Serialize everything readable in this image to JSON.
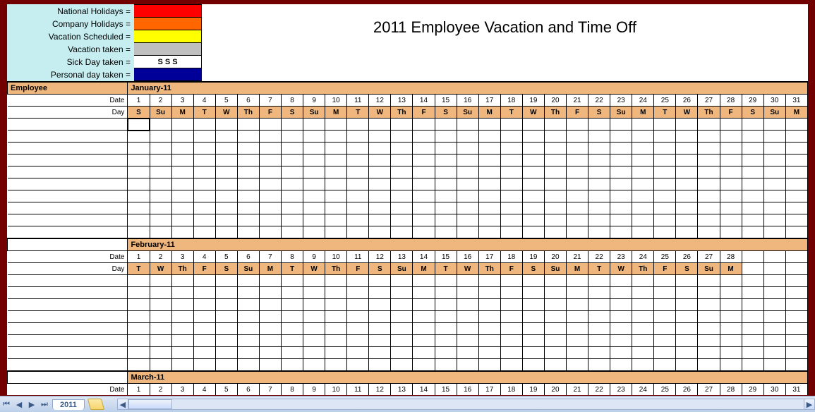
{
  "title": "2011 Employee Vacation and Time Off",
  "legend": [
    {
      "label": "National Holidays =",
      "color": "#ff0000",
      "text": ""
    },
    {
      "label": "Company Holidays =",
      "color": "#ff6600",
      "text": ""
    },
    {
      "label": "Vacation Scheduled =",
      "color": "#ffff00",
      "text": ""
    },
    {
      "label": "Vacation taken =",
      "color": "#bfbfbf",
      "text": ""
    },
    {
      "label": "Sick Day taken =",
      "color": "#ffffff",
      "text": "S      S      S"
    },
    {
      "label": "Personal day taken =",
      "color": "#000099",
      "text": ""
    }
  ],
  "labels": {
    "employee": "Employee",
    "date": "Date",
    "day": "Day"
  },
  "months": [
    {
      "name": "January-11",
      "dates": [
        "1",
        "2",
        "3",
        "4",
        "5",
        "6",
        "7",
        "8",
        "9",
        "10",
        "11",
        "12",
        "13",
        "14",
        "15",
        "16",
        "17",
        "18",
        "19",
        "20",
        "21",
        "22",
        "23",
        "24",
        "25",
        "26",
        "27",
        "28",
        "29",
        "30",
        "31"
      ],
      "days": [
        "S",
        "Su",
        "M",
        "T",
        "W",
        "Th",
        "F",
        "S",
        "Su",
        "M",
        "T",
        "W",
        "Th",
        "F",
        "S",
        "Su",
        "M",
        "T",
        "W",
        "Th",
        "F",
        "S",
        "Su",
        "M",
        "T",
        "W",
        "Th",
        "F",
        "S",
        "Su",
        "M"
      ],
      "blank_rows": 10
    },
    {
      "name": "February-11",
      "dates": [
        "1",
        "2",
        "3",
        "4",
        "5",
        "6",
        "7",
        "8",
        "9",
        "10",
        "11",
        "12",
        "13",
        "14",
        "15",
        "16",
        "17",
        "18",
        "19",
        "20",
        "21",
        "22",
        "23",
        "24",
        "25",
        "26",
        "27",
        "28",
        "",
        "",
        ""
      ],
      "days": [
        "T",
        "W",
        "Th",
        "F",
        "S",
        "Su",
        "M",
        "T",
        "W",
        "Th",
        "F",
        "S",
        "Su",
        "M",
        "T",
        "W",
        "Th",
        "F",
        "S",
        "Su",
        "M",
        "T",
        "W",
        "Th",
        "F",
        "S",
        "Su",
        "M",
        "",
        "",
        ""
      ],
      "blank_rows": 8
    },
    {
      "name": "March-11",
      "dates": [
        "1",
        "2",
        "3",
        "4",
        "5",
        "6",
        "7",
        "8",
        "9",
        "10",
        "11",
        "12",
        "13",
        "14",
        "15",
        "16",
        "17",
        "18",
        "19",
        "20",
        "21",
        "22",
        "23",
        "24",
        "25",
        "26",
        "27",
        "28",
        "29",
        "30",
        "31"
      ],
      "days": [],
      "blank_rows": 0
    }
  ],
  "tab": "2011"
}
